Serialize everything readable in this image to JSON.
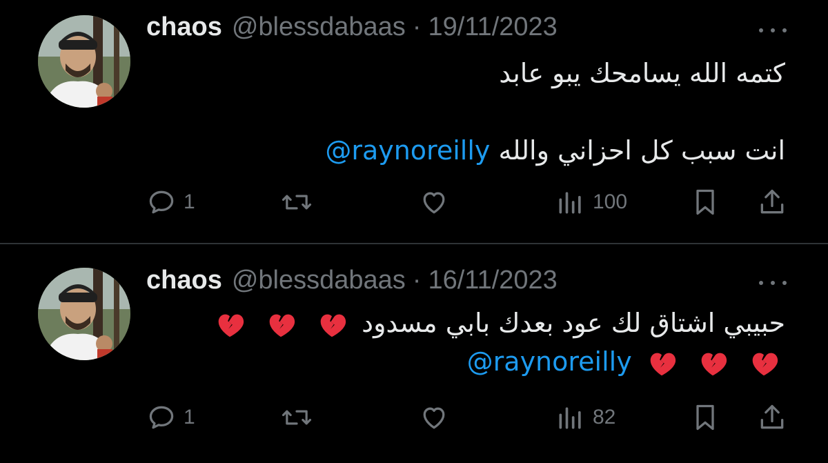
{
  "colors": {
    "background": "#000000",
    "text": "#e7e9ea",
    "muted": "#71767b",
    "link": "#1d9bf0",
    "divider": "#2f3336",
    "broken_heart": "#e8303f"
  },
  "tweets": [
    {
      "display_name": "chaos",
      "handle": "@blessdabaas",
      "separator": "·",
      "date": "19/11/2023",
      "lines": [
        "كتمه الله يسامحك يبو عابد",
        "",
        "انت سبب كل احزاني والله"
      ],
      "mention": "@raynoreilly",
      "metrics": {
        "replies": "1",
        "views": "100"
      },
      "icons": [
        "reply-icon",
        "retweet-icon",
        "like-icon",
        "views-icon",
        "bookmark-icon",
        "share-icon",
        "more-icon"
      ]
    },
    {
      "display_name": "chaos",
      "handle": "@blessdabaas",
      "separator": "·",
      "date": "16/11/2023",
      "lines": [
        "حبيبي اشتاق لك عود بعدك بابي مسدود"
      ],
      "emoji": "broken-heart",
      "emoji_count_line1": 3,
      "emoji_count_line2": 3,
      "mention": "@raynoreilly",
      "metrics": {
        "replies": "1",
        "views": "82"
      },
      "icons": [
        "reply-icon",
        "retweet-icon",
        "like-icon",
        "views-icon",
        "bookmark-icon",
        "share-icon",
        "more-icon"
      ]
    }
  ]
}
